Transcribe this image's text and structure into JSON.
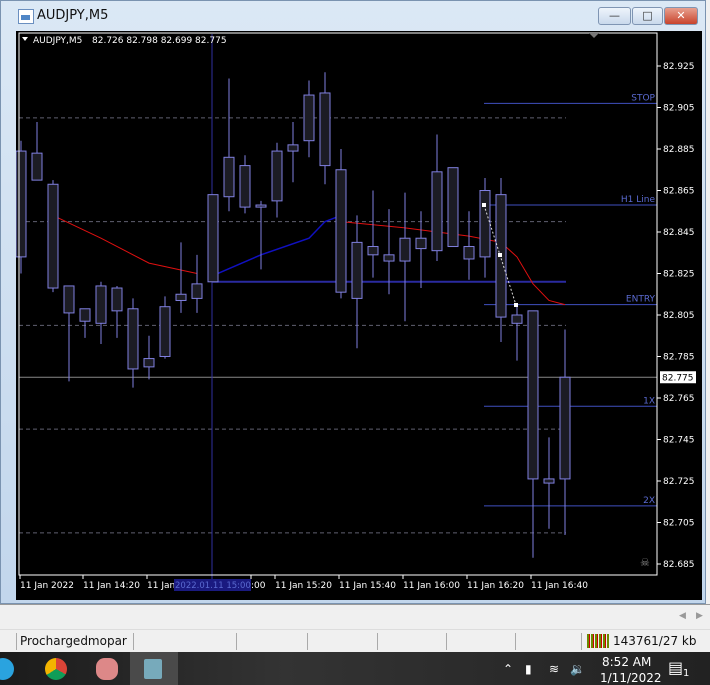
{
  "window": {
    "title": "AUDJPY,M5",
    "icon": "chart-window-icon",
    "buttons": [
      "minimize",
      "maximize",
      "close"
    ]
  },
  "chart_data": {
    "type": "candlestick",
    "symbol_header": "AUDJPY,M5",
    "ohlc_header": "82.726 82.798 82.699 82.775",
    "price_axis": {
      "range": [
        82.685,
        82.925
      ],
      "ticks": [
        "82.925",
        "82.905",
        "82.885",
        "82.865",
        "82.845",
        "82.825",
        "82.805",
        "82.785",
        "82.765",
        "82.745",
        "82.725",
        "82.705",
        "82.685"
      ]
    },
    "bid": {
      "price": 82.775,
      "label": "82.775"
    },
    "time_labels": [
      "11 Jan 2022",
      "11 Jan 14:20",
      "11 Jan",
      ":00",
      "11 Jan 15:20",
      "11 Jan 15:40",
      "11 Jan 16:00",
      "11 Jan 16:20",
      "11 Jan 16:40"
    ],
    "crosshair_time_label": "2022.01.11 15:00",
    "candles": [
      [
        82.833,
        82.889,
        82.825,
        82.884
      ],
      [
        82.883,
        82.898,
        82.87,
        82.87
      ],
      [
        82.868,
        82.87,
        82.816,
        82.818
      ],
      [
        82.819,
        82.819,
        82.773,
        82.806
      ],
      [
        82.802,
        82.808,
        82.794,
        82.808
      ],
      [
        82.801,
        82.821,
        82.791,
        82.819
      ],
      [
        82.818,
        82.819,
        82.794,
        82.807
      ],
      [
        82.808,
        82.813,
        82.77,
        82.779
      ],
      [
        82.78,
        82.795,
        82.774,
        82.784
      ],
      [
        82.785,
        82.814,
        82.784,
        82.809
      ],
      [
        82.812,
        82.84,
        82.806,
        82.815
      ],
      [
        82.813,
        82.834,
        82.806,
        82.82
      ],
      [
        82.821,
        82.863,
        82.821,
        82.863
      ],
      [
        82.862,
        82.919,
        82.855,
        82.881
      ],
      [
        82.877,
        82.882,
        82.854,
        82.857
      ],
      [
        82.857,
        82.86,
        82.827,
        82.858
      ],
      [
        82.86,
        82.888,
        82.852,
        82.884
      ],
      [
        82.884,
        82.898,
        82.869,
        82.887
      ],
      [
        82.889,
        82.918,
        82.881,
        82.911
      ],
      [
        82.912,
        82.922,
        82.868,
        82.877
      ],
      [
        82.875,
        82.885,
        82.813,
        82.816
      ],
      [
        82.813,
        82.853,
        82.789,
        82.84
      ],
      [
        82.838,
        82.865,
        82.823,
        82.834
      ],
      [
        82.831,
        82.856,
        82.815,
        82.834
      ],
      [
        82.831,
        82.864,
        82.802,
        82.842
      ],
      [
        82.837,
        82.855,
        82.818,
        82.842
      ],
      [
        82.836,
        82.892,
        82.831,
        82.874
      ],
      [
        82.876,
        82.876,
        82.838,
        82.838
      ],
      [
        82.838,
        82.855,
        82.822,
        82.832
      ],
      [
        82.833,
        82.871,
        82.823,
        82.865
      ],
      [
        82.863,
        82.871,
        82.792,
        82.804
      ],
      [
        82.805,
        82.81,
        82.783,
        82.801
      ],
      [
        82.807,
        82.807,
        82.688,
        82.726
      ],
      [
        82.726,
        82.746,
        82.702,
        82.724
      ],
      [
        82.726,
        82.798,
        82.699,
        82.775
      ]
    ],
    "levels": [
      {
        "label": "STOP",
        "price": 82.907
      },
      {
        "label": "H1 Line",
        "price": 82.858
      },
      {
        "label": "ENTRY",
        "price": 82.81
      },
      {
        "label": "1X",
        "price": 82.761
      },
      {
        "label": "2X",
        "price": 82.713
      }
    ],
    "dashed_levels": [
      82.9,
      82.85,
      82.8,
      82.75,
      82.7
    ],
    "support_line": 82.821,
    "ma_red": [
      [
        2,
        82.853
      ],
      [
        5,
        82.842
      ],
      [
        8,
        82.83
      ],
      [
        11,
        82.825
      ],
      [
        20,
        82.85
      ],
      [
        24,
        82.847
      ],
      [
        28,
        82.843
      ],
      [
        30,
        82.84
      ],
      [
        31,
        82.833
      ],
      [
        32,
        82.82
      ],
      [
        33,
        82.812
      ],
      [
        34,
        82.81
      ]
    ],
    "ma_blue": [
      [
        12,
        82.824
      ],
      [
        15,
        82.834
      ],
      [
        18,
        82.842
      ],
      [
        19,
        82.85
      ],
      [
        20,
        82.853
      ]
    ],
    "colors": {
      "background": "#000000",
      "candle": "#8080e0",
      "body": "#1c1c24",
      "ma_red": "#e01010",
      "ma_blue": "#1010c0",
      "level": "#4050c0",
      "grid": "#606070"
    }
  },
  "status_bar": {
    "profile": "Prochargedmopar",
    "traffic": "143761/27 kb"
  },
  "taskbar": {
    "apps": [
      "telegram",
      "chrome",
      "snipping-tool",
      "metatrader"
    ],
    "time": "8:52 AM",
    "date": "1/11/2022",
    "notifications": "1"
  }
}
